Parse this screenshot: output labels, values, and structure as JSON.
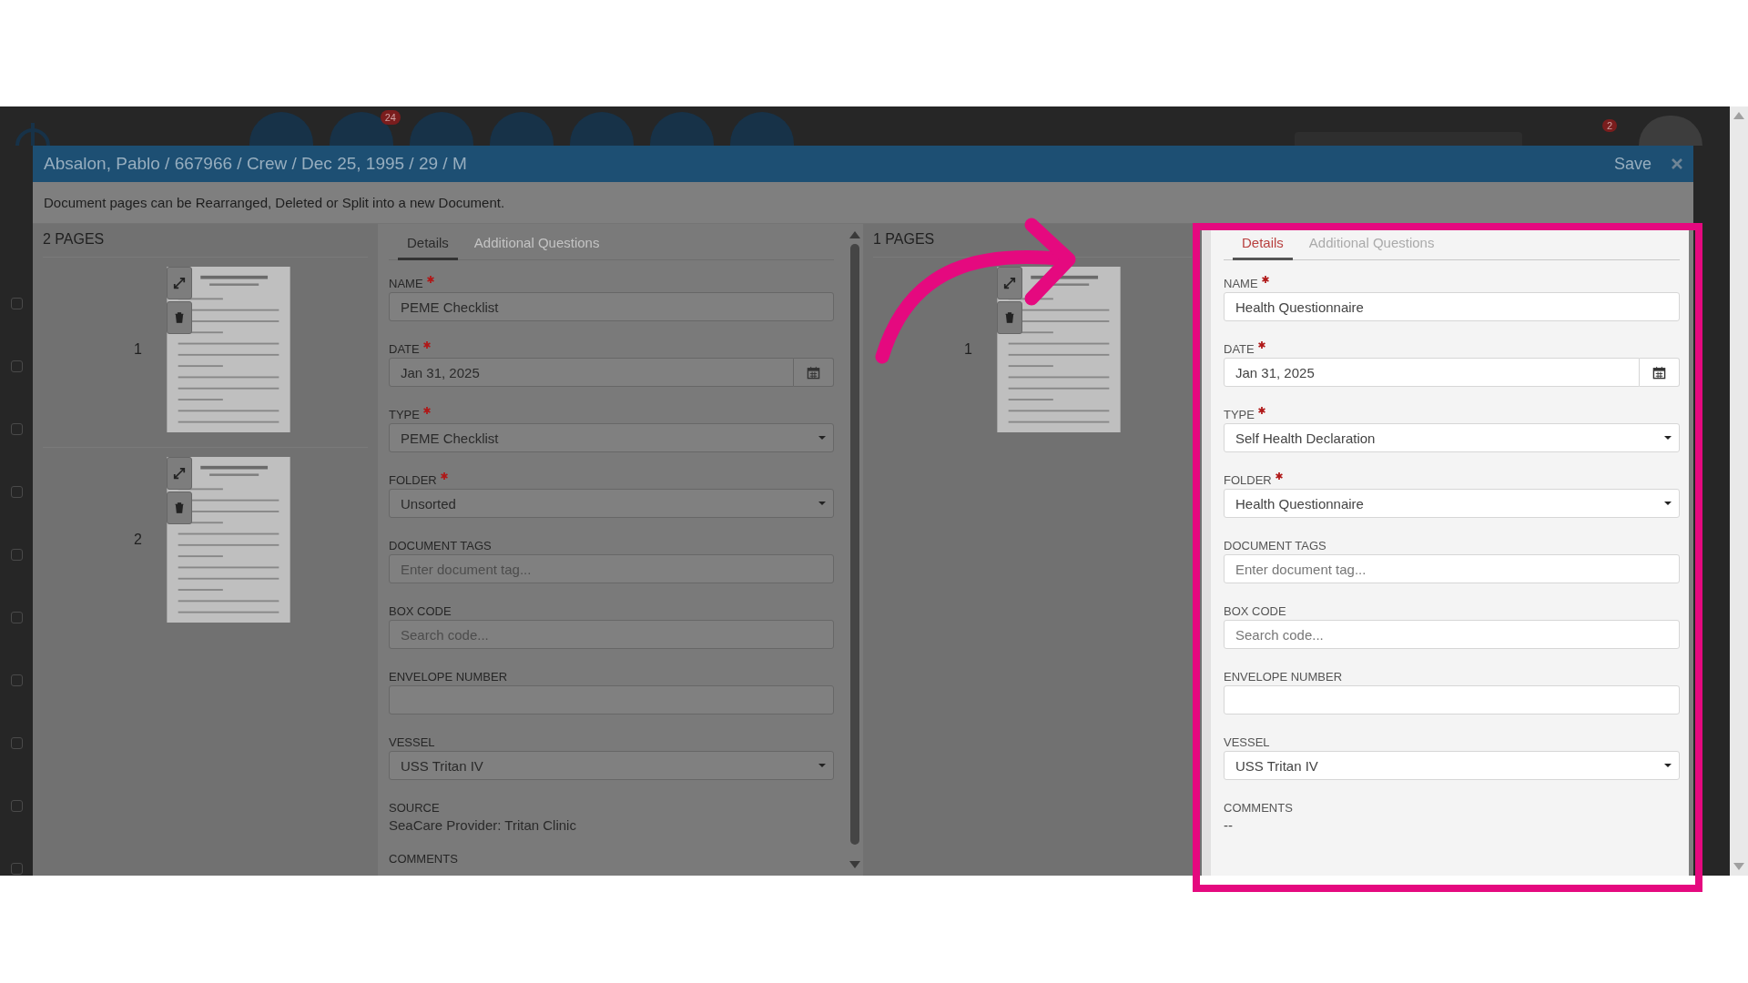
{
  "app_bar": {
    "nav_badge": "24",
    "notification_badge": "2"
  },
  "list_rows": [
    {
      "checked": false
    },
    {
      "checked": false
    },
    {
      "checked": false
    },
    {
      "checked": false
    },
    {
      "checked": false
    },
    {
      "checked": false
    },
    {
      "checked": false
    },
    {
      "checked": false
    },
    {
      "checked": false
    },
    {
      "checked": false
    }
  ],
  "header": {
    "title": "Absalon, Pablo / 667966 / Crew / Dec 25, 1995 / 29 / M",
    "save": "Save"
  },
  "message": "Document pages can be Rearranged, Deleted or Split into a new Document.",
  "documents": [
    {
      "pages_label": "2 PAGES",
      "highlighted": false,
      "pages": [
        {
          "number": "1"
        },
        {
          "number": "2"
        }
      ],
      "tabs": [
        {
          "label": "Details",
          "selected": true
        },
        {
          "label": "Additional Questions",
          "selected": false
        }
      ],
      "fields": [
        {
          "kind": "text",
          "label": "NAME",
          "required": true,
          "value": "PEME Checklist"
        },
        {
          "kind": "date",
          "label": "DATE",
          "required": true,
          "value": "Jan 31, 2025"
        },
        {
          "kind": "select",
          "label": "TYPE",
          "required": true,
          "value": "PEME Checklist"
        },
        {
          "kind": "select",
          "label": "FOLDER",
          "required": true,
          "value": "Unsorted"
        },
        {
          "kind": "text",
          "label": "DOCUMENT TAGS",
          "required": false,
          "placeholder": "Enter document tag..."
        },
        {
          "kind": "text",
          "label": "BOX CODE",
          "required": false,
          "placeholder": "Search code..."
        },
        {
          "kind": "text",
          "label": "ENVELOPE NUMBER",
          "required": false
        },
        {
          "kind": "select",
          "label": "VESSEL",
          "required": false,
          "value": "USS Tritan IV"
        },
        {
          "kind": "info",
          "label": "SOURCE",
          "required": false,
          "value": "SeaCare Provider: Tritan Clinic"
        },
        {
          "kind": "info",
          "label": "COMMENTS",
          "required": false
        }
      ]
    },
    {
      "pages_label": "1 PAGES",
      "highlighted": true,
      "pages": [
        {
          "number": "1"
        }
      ],
      "tabs": [
        {
          "label": "Details",
          "selected": true
        },
        {
          "label": "Additional Questions",
          "selected": false
        }
      ],
      "fields": [
        {
          "kind": "text",
          "label": "NAME",
          "required": true,
          "value": "Health Questionnaire"
        },
        {
          "kind": "date",
          "label": "DATE",
          "required": true,
          "value": "Jan 31, 2025"
        },
        {
          "kind": "select",
          "label": "TYPE",
          "required": true,
          "value": "Self Health Declaration"
        },
        {
          "kind": "select",
          "label": "FOLDER",
          "required": true,
          "value": "Health Questionnaire"
        },
        {
          "kind": "text",
          "label": "DOCUMENT TAGS",
          "required": false,
          "placeholder": "Enter document tag..."
        },
        {
          "kind": "text",
          "label": "BOX CODE",
          "required": false,
          "placeholder": "Search code..."
        },
        {
          "kind": "text",
          "label": "ENVELOPE NUMBER",
          "required": false
        },
        {
          "kind": "select",
          "label": "VESSEL",
          "required": false,
          "value": "USS Tritan IV"
        },
        {
          "kind": "info",
          "label": "COMMENTS",
          "required": false,
          "value": "--"
        }
      ]
    }
  ]
}
